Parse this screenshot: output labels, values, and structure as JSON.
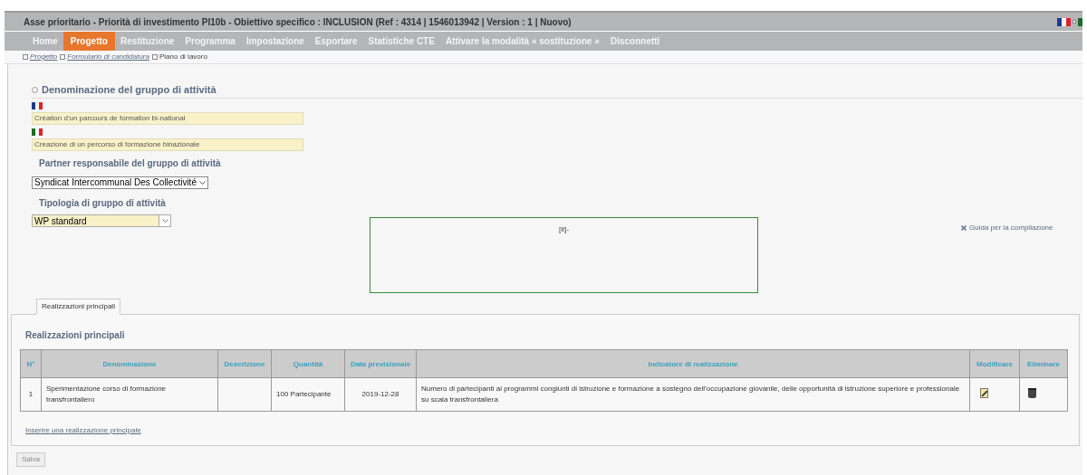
{
  "header": {
    "title": "Asse prioritario - Priorità di investimento PI10b - Obiettivo specifico : INCLUSION (Ref : 4314 | 1546013942 | Version : 1 | Nuovo)"
  },
  "nav": [
    {
      "label": "Home",
      "selected": false
    },
    {
      "label": "Progetto",
      "selected": true
    },
    {
      "label": "Restituzione",
      "selected": false
    },
    {
      "label": "Programma",
      "selected": false
    },
    {
      "label": "Impostazione",
      "selected": false
    },
    {
      "label": "Esportare",
      "selected": false
    },
    {
      "label": "Statistiche CTE",
      "selected": false
    },
    {
      "label": "Attivare la modalità « sostituzione »",
      "selected": false
    },
    {
      "label": "Disconnetti",
      "selected": false
    }
  ],
  "breadcrumb": [
    {
      "label": "Progetto",
      "kind": "link"
    },
    {
      "label": "Formulario di candidatura",
      "kind": "link"
    },
    {
      "label": "Piano di lavoro",
      "kind": "text"
    }
  ],
  "section": {
    "title": "Denominazione del gruppo di attività",
    "names": [
      {
        "kind": "french",
        "value": "Création d'un parcours de formation bi-national"
      },
      {
        "kind": "italian",
        "value": "Creazione di un percorso di formazione binazionale"
      }
    ],
    "partner_label": "Partner responsabile del gruppo di attività",
    "partner_value": "Syndicat Intercommunal Des Collectivité",
    "type_label": "Tipologia di gruppo di attività",
    "type_value": "WP standard",
    "editor_text": "[it]-",
    "guide_link": "Guida per la compilazione"
  },
  "tabs": [
    {
      "label": "Realizzazioni principali",
      "selected": true
    }
  ],
  "panel": {
    "title": "Realizzazioni principali",
    "table": {
      "columns": [
        "N°",
        "Denominazione",
        "Descrizione",
        "Quantità",
        "Data previsionale",
        "Indicatore di realizzazione",
        "Modificare",
        "Eliminare"
      ],
      "rows": [
        {
          "number": "1",
          "name": "Sperimentazione corso di formazione transfrontaliero",
          "quantity": "100 Partecipante",
          "date": "2019-12-28",
          "indicator": "Numero di partecipanti ai programmi congiunti di istruzione e formazione a sostegno dell’occupazione giovanile, delle opportunità di istruzione superiore e professionale su scala transfrontaliera"
        }
      ]
    },
    "add_link": "Inserire una realizzazione principale"
  },
  "save_button": "Salva"
}
